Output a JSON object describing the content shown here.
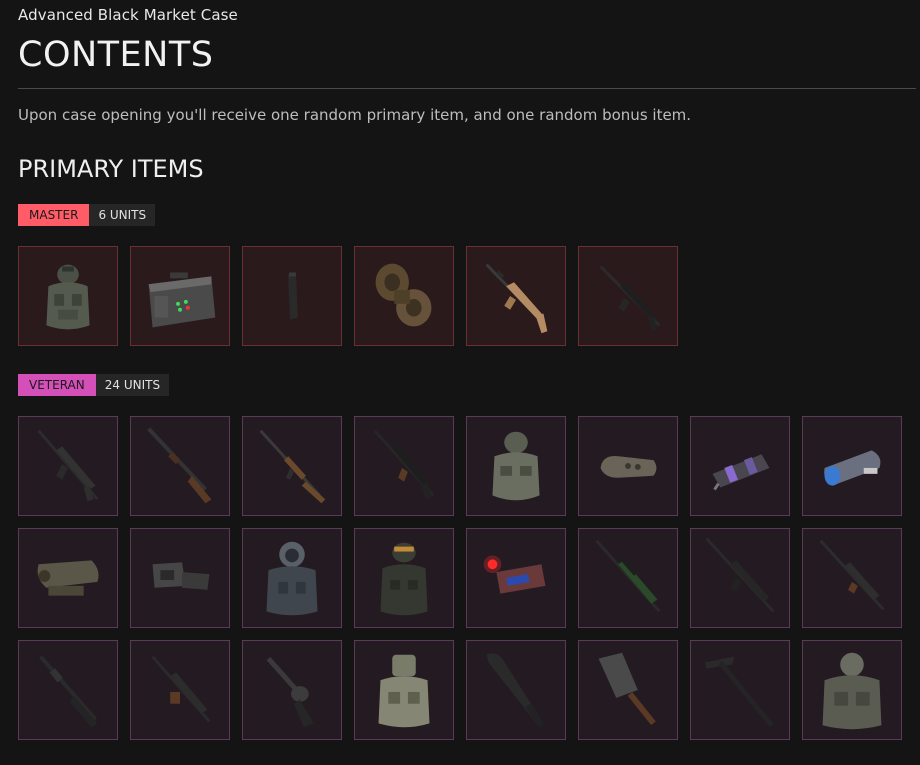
{
  "header": {
    "case_name": "Advanced Black Market Case",
    "title": "CONTENTS",
    "description": "Upon case opening you'll receive one random primary item, and one random bonus item."
  },
  "sections": {
    "primary_title": "PRIMARY ITEMS"
  },
  "tiers": {
    "master": {
      "label": "MASTER",
      "count": "6 UNITS",
      "color": "#ff5c67",
      "items": [
        {
          "icon": "armor-vest-icon"
        },
        {
          "icon": "ammo-crate-icon"
        },
        {
          "icon": "magazine-icon"
        },
        {
          "icon": "drum-magazine-icon"
        },
        {
          "icon": "desert-rifle-icon"
        },
        {
          "icon": "black-rifle-icon"
        }
      ]
    },
    "veteran": {
      "label": "VETERAN",
      "count": "24 UNITS",
      "color": "#d44fb8",
      "items": [
        {
          "icon": "assault-rifle-icon"
        },
        {
          "icon": "shotgun-icon"
        },
        {
          "icon": "wood-rifle-icon"
        },
        {
          "icon": "smg-rifle-icon"
        },
        {
          "icon": "armor-suit-icon"
        },
        {
          "icon": "muzzle-brake-icon"
        },
        {
          "icon": "purple-suppressor-icon"
        },
        {
          "icon": "blue-tactical-light-icon"
        },
        {
          "icon": "scope-sight-icon"
        },
        {
          "icon": "red-dot-sight-icon"
        },
        {
          "icon": "hazmat-suit-icon"
        },
        {
          "icon": "tactical-helmet-suit-icon"
        },
        {
          "icon": "laser-module-icon"
        },
        {
          "icon": "sniper-rifle-icon"
        },
        {
          "icon": "long-rifle-icon"
        },
        {
          "icon": "battle-rifle-icon"
        },
        {
          "icon": "pump-shotgun-icon"
        },
        {
          "icon": "drum-smg-icon"
        },
        {
          "icon": "revolver-icon"
        },
        {
          "icon": "heavy-armor-icon"
        },
        {
          "icon": "machete-icon"
        },
        {
          "icon": "cleaver-icon"
        },
        {
          "icon": "ice-axe-icon"
        },
        {
          "icon": "juggernaut-armor-icon"
        }
      ]
    }
  }
}
